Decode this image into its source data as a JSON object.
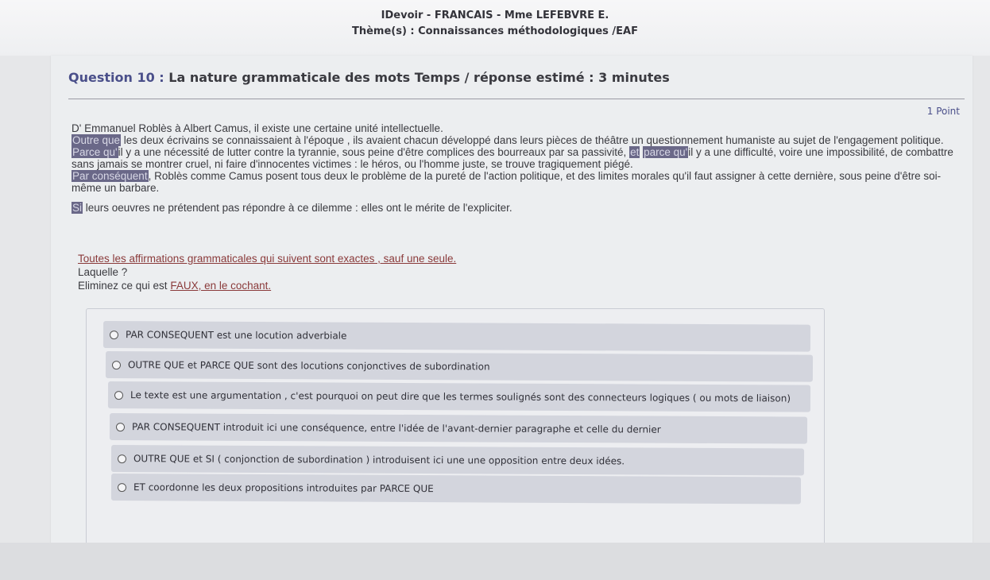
{
  "header": {
    "title": "IDevoir - FRANCAIS - Mme LEFEBVRE E.",
    "theme": "Thème(s) : Connaissances méthodologiques /EAF"
  },
  "question": {
    "label": "Question 10 :",
    "title": "La nature grammaticale des mots Temps / réponse estimé : 3 minutes",
    "points": "1 Point"
  },
  "passage": {
    "p1": "D' Emmanuel Roblès à Albert Camus, il existe une certaine unité intellectuelle.",
    "p2_hl": "Outre que",
    "p2": " les deux écrivains se connaissaient à l'époque , ils avaient chacun développé dans leurs pièces de théâtre un questionnement  humaniste au sujet de l'engagement politique.",
    "p3_hl": "Parce qu'",
    "p3a": "il y a une nécessité de lutter contre la tyrannie, sous peine d'être complices des bourreaux par sa passivité, ",
    "p3_hl2": "et",
    "p3b": "    ",
    "p3_hl3": "parce qu'",
    "p3c": "il y a une difficulté, voire une impossibilité,  de combattre sans jamais se montrer cruel, ni faire d'innocentes victimes : le héros, ou l'homme juste, se trouve tragiquement piégé.",
    "p4_hl": "Par conséquent",
    "p4": ", Roblès comme Camus posent tous deux le problème de la pureté de l'action politique, et des limites morales qu'il faut assigner à cette dernière, sous peine d'être soi-même un barbare.",
    "p5_hl": "Si",
    "p5": " leurs oeuvres ne prétendent pas répondre à ce dilemme  : elles ont le mérite de l'expliciter."
  },
  "instructions": {
    "line1": "Toutes les affirmations grammaticales qui suivent sont exactes , sauf une seule.",
    "line2": "Laquelle ?",
    "line3_pre": "Eliminez ce qui est ",
    "line3_link": "FAUX, en le cochant."
  },
  "options": [
    "PAR CONSEQUENT est une locution adverbiale",
    "OUTRE QUE et PARCE QUE sont des locutions conjonctives de subordination",
    "Le texte est une argumentation , c'est pourquoi on peut dire que les termes soulignés sont des connecteurs logiques ( ou mots de liaison)",
    "PAR CONSEQUENT introduit ici une conséquence, entre l'idée de l'avant-dernier paragraphe et celle du dernier",
    "OUTRE QUE et SI ( conjonction de subordination ) introduisent ici une une opposition entre deux idées.",
    "ET coordonne les deux propositions introduites par PARCE QUE"
  ]
}
